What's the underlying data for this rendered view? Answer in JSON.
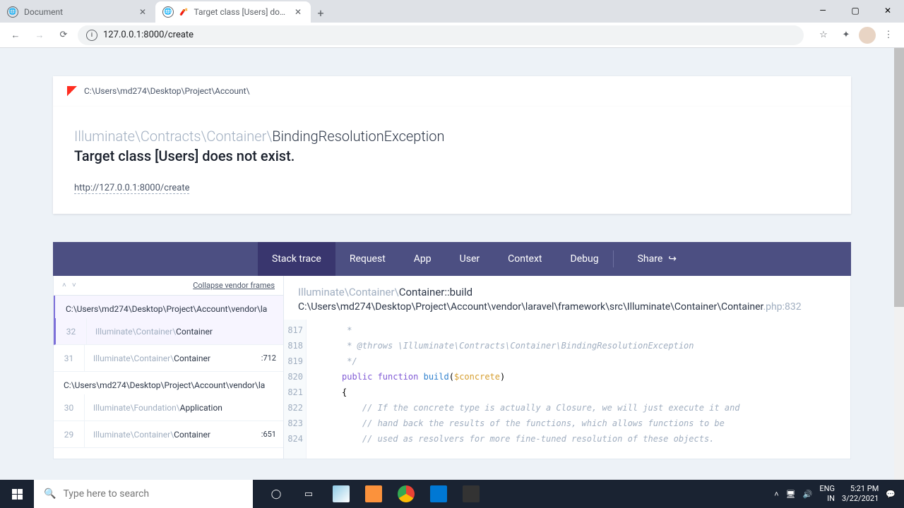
{
  "browser": {
    "tabs": [
      {
        "title": "Document"
      },
      {
        "title": "Target class [Users] does not"
      }
    ],
    "url": "127.0.0.1:8000/create"
  },
  "page": {
    "project_path": "C:\\Users\\md274\\Desktop\\Project\\Account\\",
    "exception_ns": "Illuminate\\Contracts\\Container\\",
    "exception_class": "BindingResolutionException",
    "error_message": "Target class [Users] does not exist.",
    "error_url": "http://127.0.0.1:8000/create"
  },
  "nav": {
    "tabs": [
      "Stack trace",
      "Request",
      "App",
      "User",
      "Context",
      "Debug"
    ],
    "share": "Share"
  },
  "trace": {
    "collapse_label": "Collapse vendor frames",
    "group1_path": "C:\\Users\\md274\\Desktop\\Project\\Account\\vendor\\la",
    "frames": [
      {
        "num": "32",
        "ns": "Illuminate\\Container\\",
        "class": "Container",
        "line": ""
      },
      {
        "num": "31",
        "ns": "Illuminate\\Container\\",
        "class": "Container",
        "line": ":712"
      }
    ],
    "group2_path": "C:\\Users\\md274\\Desktop\\Project\\Account\\vendor\\la",
    "frames2": [
      {
        "num": "30",
        "ns": "Illuminate\\Foundation\\",
        "class": "Application",
        "line": ""
      },
      {
        "num": "29",
        "ns": "Illuminate\\Container\\",
        "class": "Container",
        "line": ":651"
      }
    ]
  },
  "code": {
    "header_ns": "Illuminate\\Container\\",
    "header_method": "Container::build",
    "path_main": "C:\\Users\\md274\\Desktop\\Project\\Account\\vendor\\laravel\\framework\\src\\Illuminate\\Container\\Container",
    "path_ext": ".php:832",
    "lines": [
      817,
      818,
      819,
      820,
      821,
      822,
      823,
      824
    ],
    "src": {
      "l817": " *",
      "l818": " * @throws \\Illuminate\\Contracts\\Container\\BindingResolutionException",
      "l819": " */",
      "l820a": "public",
      "l820b": " function ",
      "l820c": "build",
      "l820d": "(",
      "l820e": "$concrete",
      "l820f": ")",
      "l821": "{",
      "l822": "    // If the concrete type is actually a Closure, we will just execute it and",
      "l823": "    // hand back the results of the functions, which allows functions to be",
      "l824": "    // used as resolvers for more fine-tuned resolution of these objects."
    }
  },
  "taskbar": {
    "search_placeholder": "Type here to search",
    "lang1": "ENG",
    "lang2": "IN",
    "time": "5:21 PM",
    "date": "3/22/2021"
  }
}
